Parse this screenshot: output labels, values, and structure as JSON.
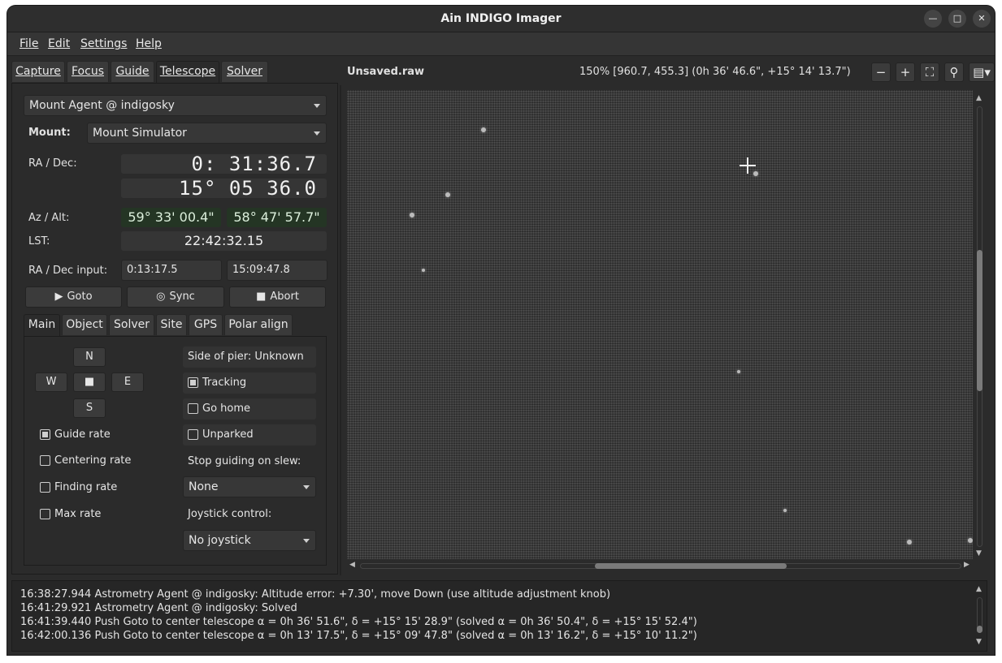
{
  "window": {
    "title": "Ain INDIGO Imager"
  },
  "menu": [
    "File",
    "Edit",
    "Settings",
    "Help"
  ],
  "main_tabs": [
    "Capture",
    "Focus",
    "Guide",
    "Telescope",
    "Solver"
  ],
  "active_main_tab": "Telescope",
  "telescope": {
    "agent": "Mount Agent @ indigosky",
    "mount_label": "Mount:",
    "mount": "Mount Simulator",
    "radec_label": "RA / Dec:",
    "ra": "0: 31:36.7",
    "dec": "15° 05 36.0",
    "azalt_label": "Az / Alt:",
    "az": "59° 33' 00.4\"",
    "alt": "58° 47' 57.7\"",
    "lst_label": "LST:",
    "lst": "22:42:32.15",
    "radec_input_label": "RA / Dec input:",
    "ra_input": "0:13:17.5",
    "dec_input": "15:09:47.8",
    "goto": "Goto",
    "sync": "Sync",
    "abort": "Abort"
  },
  "sub_tabs": [
    "Main",
    "Object",
    "Solver",
    "Site",
    "GPS",
    "Polar align"
  ],
  "active_sub_tab": "Main",
  "main": {
    "dir_n": "N",
    "dir_w": "W",
    "dir_stop": "■",
    "dir_e": "E",
    "dir_s": "S",
    "guide_rate": "Guide rate",
    "centering_rate": "Centering rate",
    "finding_rate": "Finding rate",
    "max_rate": "Max rate",
    "side_of_pier": "Side of pier: Unknown",
    "tracking": "Tracking",
    "go_home": "Go home",
    "unparked": "Unparked",
    "stop_guiding_label": "Stop guiding on slew:",
    "stop_guiding_value": "None",
    "joystick_label": "Joystick control:",
    "joystick_value": "No joystick",
    "checks": {
      "guide_rate": true,
      "centering_rate": false,
      "finding_rate": false,
      "max_rate": false,
      "tracking": true,
      "go_home": false,
      "unparked": false
    }
  },
  "image": {
    "filename": "Unsaved.raw",
    "info": "150% [960.7, 455.3] (0h 36' 46.6\", +15° 14' 13.7\")"
  },
  "log": [
    "16:38:27.944 Astrometry Agent @ indigosky: Altitude error: +7.30', move Down (use altitude adjustment knob)",
    "16:41:29.921 Astrometry Agent @ indigosky: Solved",
    "16:41:39.440 Push Goto to center telescope α = 0h 36' 51.6\", δ = +15° 15' 28.9\" (solved α = 0h 36' 50.4\", δ = +15° 15' 52.4\")",
    "16:42:00.136 Push Goto to center telescope α = 0h 13' 17.5\", δ = +15° 09' 47.8\" (solved α = 0h 13' 16.2\", δ = +15° 10' 11.2\")"
  ]
}
